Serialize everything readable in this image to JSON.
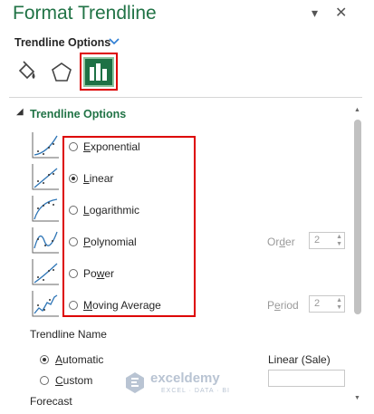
{
  "panel": {
    "title": "Format Trendline",
    "subtitle": "Trendline Options",
    "tabs": [
      {
        "icon": "paint-bucket-icon",
        "selected": false
      },
      {
        "icon": "pentagon-icon",
        "selected": false
      },
      {
        "icon": "bar-chart-icon",
        "selected": true
      }
    ]
  },
  "section": {
    "title": "Trendline Options",
    "options": [
      {
        "key": "E",
        "rest": "xponential",
        "selected": false
      },
      {
        "key": "L",
        "rest": "inear",
        "pre": "",
        "selected": true
      },
      {
        "key": "L",
        "rest": "ogarithmic",
        "selected": false
      },
      {
        "key": "P",
        "rest": "olynomial",
        "selected": false
      },
      {
        "key": "w",
        "pre": "Po",
        "rest": "er",
        "selected": false
      },
      {
        "key": "M",
        "rest": "oving Average",
        "selected": false
      }
    ],
    "order": {
      "label_key": "d",
      "label_pre": "Or",
      "label_rest": "er",
      "value": "2"
    },
    "period": {
      "label_key": "e",
      "label_pre": "P",
      "label_rest": "riod",
      "value": "2"
    }
  },
  "trendline_name": {
    "label": "Trendline Name",
    "automatic_key": "A",
    "automatic_rest": "utomatic",
    "custom_key": "C",
    "custom_rest": "ustom",
    "automatic_selected": true,
    "auto_value": "Linear (Sale)",
    "custom_value": ""
  },
  "forecast": {
    "label": "Forecast"
  },
  "watermark": {
    "brand": "exceldemy",
    "tagline": "EXCEL · DATA · BI"
  },
  "colors": {
    "accent": "#217346",
    "highlight": "#dd0000",
    "tab_selected": "#1e7145"
  }
}
